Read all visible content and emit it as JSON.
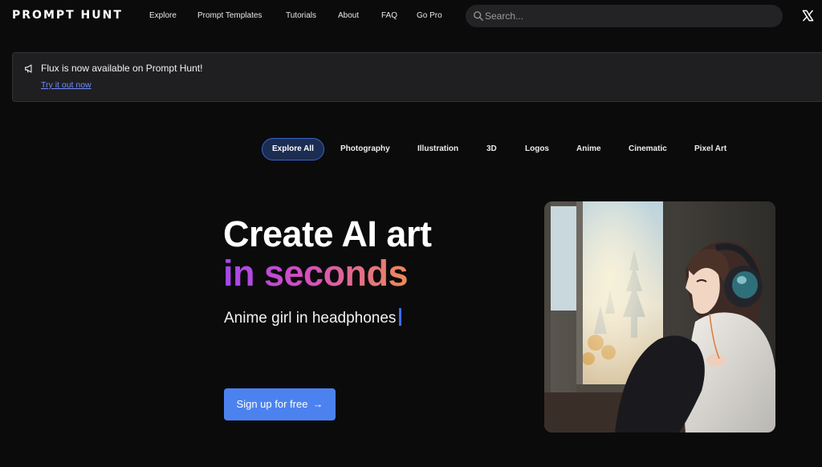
{
  "header": {
    "logo": "PROMPT HUNT",
    "nav": [
      "Explore",
      "Prompt Templates",
      "Tutorials",
      "About",
      "FAQ",
      "Go Pro"
    ],
    "search_placeholder": "Search...",
    "x_icon": "x-logo-icon"
  },
  "announcement": {
    "icon": "megaphone-icon",
    "message": "Flux is now available on Prompt Hunt!",
    "link": "Try it out now"
  },
  "categories": {
    "active": "Explore All",
    "items": [
      "Explore All",
      "Photography",
      "Illustration",
      "3D",
      "Logos",
      "Anime",
      "Cinematic",
      "Pixel Art"
    ]
  },
  "hero": {
    "title": "Create AI art",
    "subtitle": "in seconds",
    "typed_prompt": "Anime girl in headphones",
    "cta": "Sign up for free",
    "cta_icon": "arrow-right-icon"
  },
  "colors": {
    "background": "#0b0b0c",
    "accent_blue": "#4b82f0",
    "link_blue": "#6e8dff",
    "gradient": [
      "#a546f0",
      "#d44fbe",
      "#ef8a56"
    ]
  }
}
